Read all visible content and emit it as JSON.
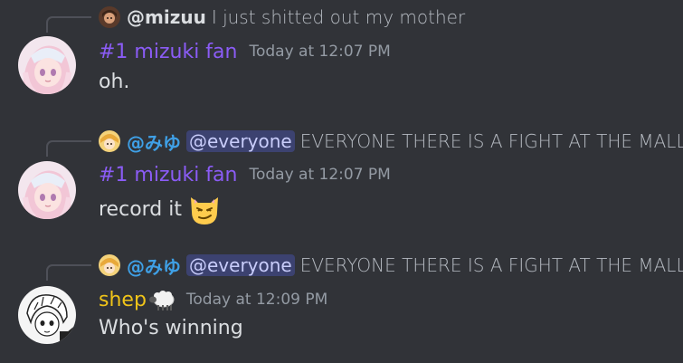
{
  "colors": {
    "background": "#313338",
    "mizuki_role": "#8b5cf6",
    "miyu_role": "#3fa0e6",
    "shep_role": "#f0c419",
    "mention_bg": "#3c4270",
    "mention_text": "#c9cdfb",
    "timestamp": "#949ba4",
    "text": "#dbdee1"
  },
  "messages": [
    {
      "reply": {
        "author": "@mizuu",
        "text": "I just shitted out my mother",
        "avatar_icon": "user-avatar-small"
      },
      "author": "#1 mizuki fan",
      "timestamp": "Today at 12:07 PM",
      "content": "oh.",
      "avatar_icon": "anime-girl-avatar"
    },
    {
      "reply": {
        "author": "@みゆ",
        "mention": "@everyone",
        "text": "EVERYONE THERE IS A FIGHT AT THE MALL",
        "avatar_icon": "anime-boy-avatar-small"
      },
      "author": "#1 mizuki fan",
      "timestamp": "Today at 12:07 PM",
      "content": "record it",
      "emoji_icon": "smirk-cat-emoji",
      "avatar_icon": "anime-girl-avatar"
    },
    {
      "reply": {
        "author": "@みゆ",
        "mention": "@everyone",
        "text": "EVERYONE THERE IS A FIGHT AT THE MALL",
        "avatar_icon": "anime-boy-avatar-small"
      },
      "author": "shep",
      "author_emoji_icon": "sheep-emoji",
      "timestamp": "Today at 12:09 PM",
      "content": "Who's winning",
      "avatar_icon": "manga-sketch-avatar"
    }
  ]
}
